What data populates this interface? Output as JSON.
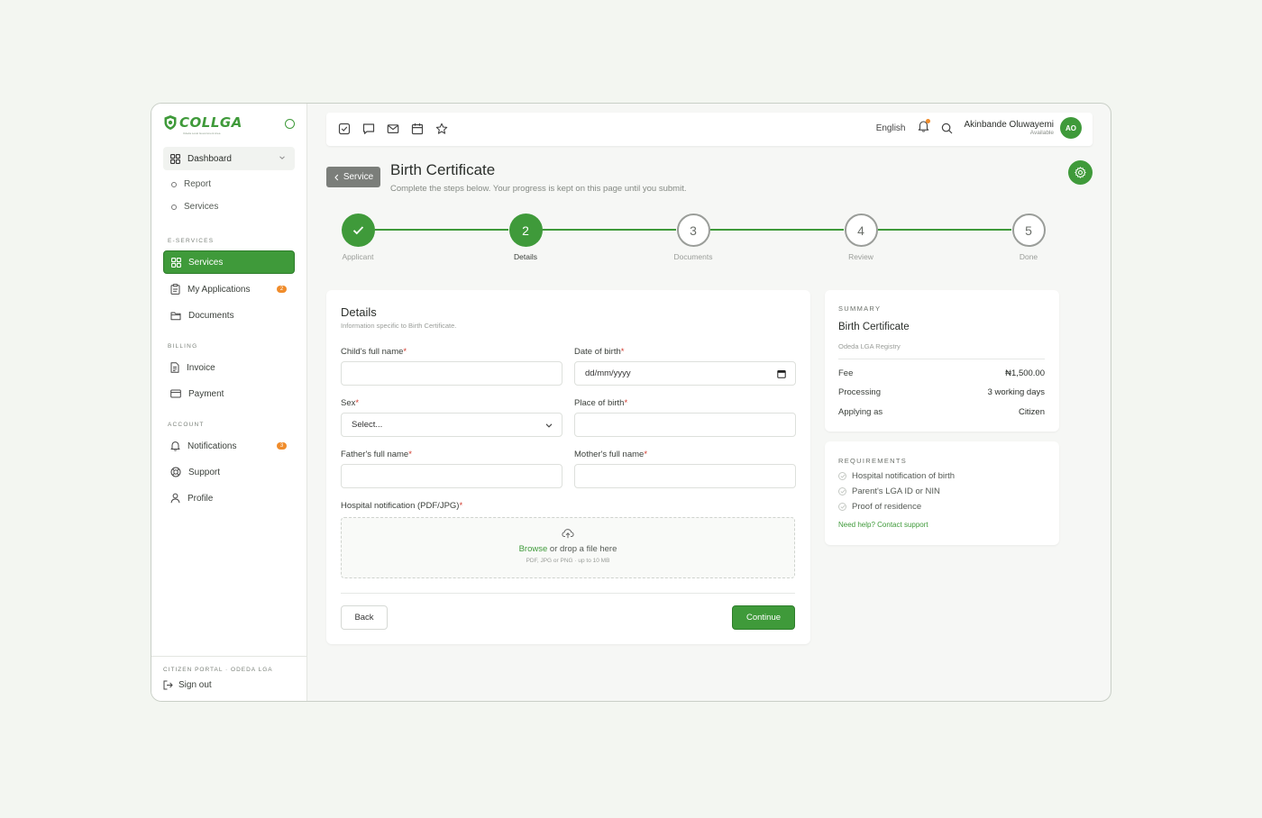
{
  "brand": {
    "name": "COLLGA",
    "tagline": "Odeda Local Government Area"
  },
  "colors": {
    "accent": "#3f9a3a",
    "badge": "#f08c2b",
    "required": "#d23b2f"
  },
  "sidebar": {
    "dashboard": {
      "label": "Dashboard",
      "icon": "grid-icon"
    },
    "dashboard_children": [
      {
        "label": "Report"
      },
      {
        "label": "Services"
      }
    ],
    "sections": {
      "eservices": "E-SERVICES",
      "billing": "BILLING",
      "account": "ACCOUNT"
    },
    "eservices_items": [
      {
        "label": "Services",
        "icon": "grid-icon",
        "active": true
      },
      {
        "label": "My Applications",
        "icon": "clipboard-icon",
        "badge": "2"
      },
      {
        "label": "Documents",
        "icon": "folder-icon"
      }
    ],
    "billing_items": [
      {
        "label": "Invoice",
        "icon": "document-icon"
      },
      {
        "label": "Payment",
        "icon": "credit-card-icon"
      }
    ],
    "account_items": [
      {
        "label": "Notifications",
        "icon": "bell-icon",
        "badge": "3"
      },
      {
        "label": "Support",
        "icon": "lifebuoy-icon"
      },
      {
        "label": "Profile",
        "icon": "user-icon"
      }
    ],
    "footer_label": "CITIZEN PORTAL · ODEDA LGA",
    "signout": "Sign out"
  },
  "topbar": {
    "icons": [
      "checkbox-icon",
      "chat-icon",
      "mail-icon",
      "calendar-icon",
      "star-icon"
    ],
    "language": "English",
    "user_name": "Akinbande Oluwayemi",
    "user_status": "Available",
    "avatar_initials": "AO"
  },
  "header": {
    "back_label": "Service",
    "title": "Birth Certificate",
    "subtitle": "Complete the steps below. Your progress is kept on this page until you submit."
  },
  "stepper": {
    "steps": [
      {
        "number": "1",
        "label": "Applicant",
        "state": "done"
      },
      {
        "number": "2",
        "label": "Details",
        "state": "current"
      },
      {
        "number": "3",
        "label": "Documents",
        "state": "todo"
      },
      {
        "number": "4",
        "label": "Review",
        "state": "todo"
      },
      {
        "number": "5",
        "label": "Done",
        "state": "todo"
      }
    ]
  },
  "form": {
    "title": "Details",
    "subtitle": "Information specific to Birth Certificate.",
    "fields": {
      "child_name": {
        "label": "Child's full name",
        "value": ""
      },
      "dob": {
        "label": "Date of birth",
        "value": "dd/mm/yyyy"
      },
      "sex": {
        "label": "Sex",
        "value": "Select..."
      },
      "place_of_birth": {
        "label": "Place of birth",
        "value": ""
      },
      "father_name": {
        "label": "Father's full name",
        "value": ""
      },
      "mother_name": {
        "label": "Mother's full name",
        "value": ""
      },
      "hospital_notification": {
        "label": "Hospital notification (PDF/JPG)"
      }
    },
    "required_mark": "*",
    "upload": {
      "browse": "Browse",
      "rest": " or drop a file here",
      "hint": "PDF, JPG or PNG · up to 10 MB"
    },
    "back_button": "Back",
    "continue_button": "Continue"
  },
  "summary": {
    "heading": "SUMMARY",
    "title": "Birth Certificate",
    "subtitle": "Odeda LGA Registry",
    "rows": [
      {
        "label": "Fee",
        "value": "₦1,500.00"
      },
      {
        "label": "Processing",
        "value": "3 working days"
      },
      {
        "label": "Applying as",
        "value": "Citizen"
      }
    ]
  },
  "requirements": {
    "heading": "REQUIREMENTS",
    "items": [
      "Hospital notification of birth",
      "Parent's LGA ID or NIN",
      "Proof of residence"
    ],
    "help_link": "Need help? Contact support"
  }
}
